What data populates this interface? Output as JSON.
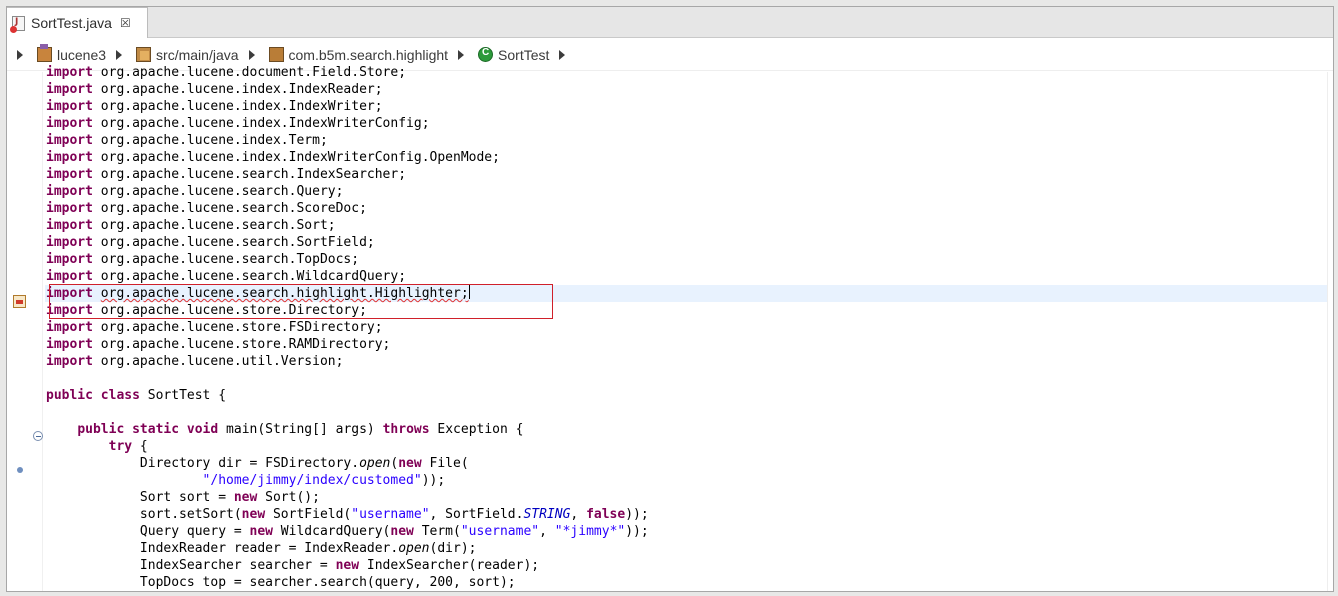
{
  "tab": {
    "title": "SortTest.java",
    "close": "☒"
  },
  "breadcrumb": [
    {
      "label": "lucene3",
      "icon": "project-icon"
    },
    {
      "label": "src/main/java",
      "icon": "source-folder-icon"
    },
    {
      "label": "com.b5m.search.highlight",
      "icon": "package-icon"
    },
    {
      "label": "SortTest",
      "icon": "class-icon"
    }
  ],
  "code": {
    "imports": [
      "org.apache.lucene.document.Field.Store;",
      "org.apache.lucene.index.IndexReader;",
      "org.apache.lucene.index.IndexWriter;",
      "org.apache.lucene.index.IndexWriterConfig;",
      "org.apache.lucene.index.Term;",
      "org.apache.lucene.index.IndexWriterConfig.OpenMode;",
      "org.apache.lucene.search.IndexSearcher;",
      "org.apache.lucene.search.Query;",
      "org.apache.lucene.search.ScoreDoc;",
      "org.apache.lucene.search.Sort;",
      "org.apache.lucene.search.SortField;",
      "org.apache.lucene.search.TopDocs;",
      "org.apache.lucene.search.WildcardQuery;",
      "org.apache.lucene.search.highlight.Highlighter;",
      "org.apache.lucene.store.Directory;",
      "org.apache.lucene.store.FSDirectory;",
      "org.apache.lucene.store.RAMDirectory;",
      "org.apache.lucene.util.Version;"
    ],
    "kw_import": "import",
    "kw_public": "public",
    "kw_class": "class",
    "class_decl": " SortTest {",
    "kw_static": "static",
    "kw_void": "void",
    "main_sig": " main(String[] args) ",
    "kw_throws": "throws",
    "main_tail": " Exception {",
    "kw_try": "try",
    "try_tail": " {",
    "l1a": "Directory dir = FSDirectory.",
    "l1b": "open",
    "l1c": "(",
    "kw_new": "new",
    "l1d": " File(",
    "l2str": "\"/home/jimmy/index/customed\"",
    "l2tail": "));",
    "l3a": "Sort sort = ",
    "l3b": " Sort();",
    "l4a": "sort.setSort(",
    "l4b": " SortField(",
    "l4str": "\"username\"",
    "l4c": ", SortField.",
    "l4stat": "STRING",
    "l4d": ", ",
    "kw_false": "false",
    "l4e": "));",
    "l5a": "Query query = ",
    "l5b": " WildcardQuery(",
    "l5c": " Term(",
    "l5str1": "\"username\"",
    "l5d": ", ",
    "l5str2": "\"*jimmy*\"",
    "l5e": "));",
    "l6a": "IndexReader reader = IndexReader.",
    "l6b": "open",
    "l6c": "(dir);",
    "l7a": "IndexSearcher searcher = ",
    "l7b": " IndexSearcher(reader);",
    "l8": "TopDocs top = searcher.search(query, 200, sort);"
  }
}
